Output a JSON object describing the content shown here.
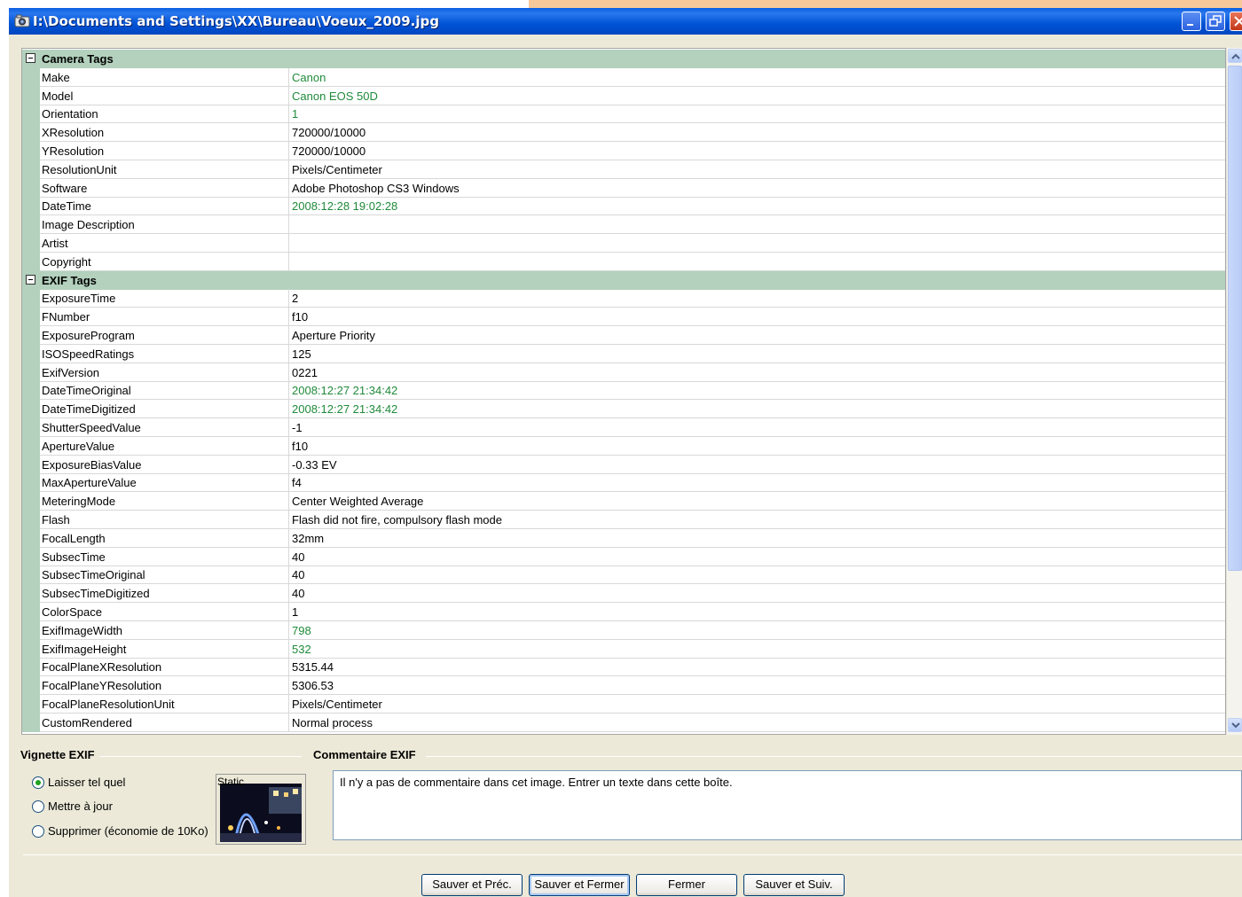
{
  "window": {
    "title": "I:\\Documents and Settings\\XX\\Bureau\\Voeux_2009.jpg"
  },
  "grid": {
    "categories": [
      {
        "title": "Camera Tags",
        "rows": [
          {
            "name": "Make",
            "value": "Canon",
            "green": true
          },
          {
            "name": "Model",
            "value": "Canon EOS 50D",
            "green": true
          },
          {
            "name": "Orientation",
            "value": "1",
            "green": true
          },
          {
            "name": "XResolution",
            "value": "720000/10000",
            "green": false
          },
          {
            "name": "YResolution",
            "value": "720000/10000",
            "green": false
          },
          {
            "name": "ResolutionUnit",
            "value": "Pixels/Centimeter",
            "green": false
          },
          {
            "name": "Software",
            "value": "Adobe Photoshop CS3 Windows",
            "green": false
          },
          {
            "name": "DateTime",
            "value": "2008:12:28 19:02:28",
            "green": true
          },
          {
            "name": "Image Description",
            "value": "",
            "green": false
          },
          {
            "name": "Artist",
            "value": "",
            "green": false
          },
          {
            "name": "Copyright",
            "value": "",
            "green": false
          }
        ]
      },
      {
        "title": "EXIF Tags",
        "rows": [
          {
            "name": "ExposureTime",
            "value": "2",
            "green": false
          },
          {
            "name": "FNumber",
            "value": "f10",
            "green": false
          },
          {
            "name": "ExposureProgram",
            "value": "Aperture Priority",
            "green": false
          },
          {
            "name": "ISOSpeedRatings",
            "value": "125",
            "green": false
          },
          {
            "name": "ExifVersion",
            "value": "0221",
            "green": false
          },
          {
            "name": "DateTimeOriginal",
            "value": "2008:12:27 21:34:42",
            "green": true
          },
          {
            "name": "DateTimeDigitized",
            "value": "2008:12:27 21:34:42",
            "green": true
          },
          {
            "name": "ShutterSpeedValue",
            "value": "-1",
            "green": false
          },
          {
            "name": "ApertureValue",
            "value": "f10",
            "green": false
          },
          {
            "name": "ExposureBiasValue",
            "value": "-0.33 EV",
            "green": false
          },
          {
            "name": "MaxApertureValue",
            "value": "f4",
            "green": false
          },
          {
            "name": "MeteringMode",
            "value": "Center Weighted Average",
            "green": false
          },
          {
            "name": "Flash",
            "value": "Flash did not fire, compulsory flash mode",
            "green": false
          },
          {
            "name": "FocalLength",
            "value": "32mm",
            "green": false
          },
          {
            "name": "SubsecTime",
            "value": "40",
            "green": false
          },
          {
            "name": "SubsecTimeOriginal",
            "value": "40",
            "green": false
          },
          {
            "name": "SubsecTimeDigitized",
            "value": "40",
            "green": false
          },
          {
            "name": "ColorSpace",
            "value": "1",
            "green": false
          },
          {
            "name": "ExifImageWidth",
            "value": "798",
            "green": true
          },
          {
            "name": "ExifImageHeight",
            "value": "532",
            "green": true
          },
          {
            "name": "FocalPlaneXResolution",
            "value": "5315.44",
            "green": false
          },
          {
            "name": "FocalPlaneYResolution",
            "value": "5306.53",
            "green": false
          },
          {
            "name": "FocalPlaneResolutionUnit",
            "value": "Pixels/Centimeter",
            "green": false
          },
          {
            "name": "CustomRendered",
            "value": "Normal process",
            "green": false
          }
        ]
      }
    ]
  },
  "vignette": {
    "title": "Vignette EXIF",
    "options": [
      "Laisser tel quel",
      "Mettre à jour",
      "Supprimer (économie de 10Ko)"
    ],
    "selected_index": 0,
    "thumb_label": "Static"
  },
  "comment": {
    "title": "Commentaire EXIF",
    "text": "Il n'y a pas de commentaire dans cet image. Entrer un texte dans cette boîte."
  },
  "buttons": {
    "prev": "Sauver et Préc.",
    "save_close": "Sauver et Fermer",
    "close": "Fermer",
    "next": "Sauver et Suiv."
  },
  "colors": {
    "titlebar": "#0053d6",
    "category_bg": "#b3d1bd",
    "green_value": "#1f8a3a"
  }
}
